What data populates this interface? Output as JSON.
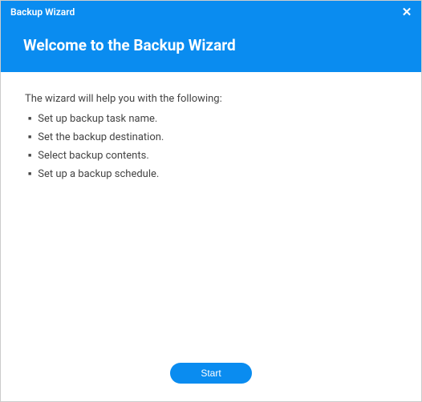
{
  "window": {
    "title": "Backup Wizard"
  },
  "header": {
    "heading": "Welcome to the Backup Wizard"
  },
  "content": {
    "intro": "The wizard will help you with the following:",
    "steps": [
      "Set up backup task name.",
      "Set the backup destination.",
      "Select backup contents.",
      "Set up a backup schedule."
    ]
  },
  "footer": {
    "start_label": "Start"
  },
  "icons": {
    "close": "✕"
  }
}
